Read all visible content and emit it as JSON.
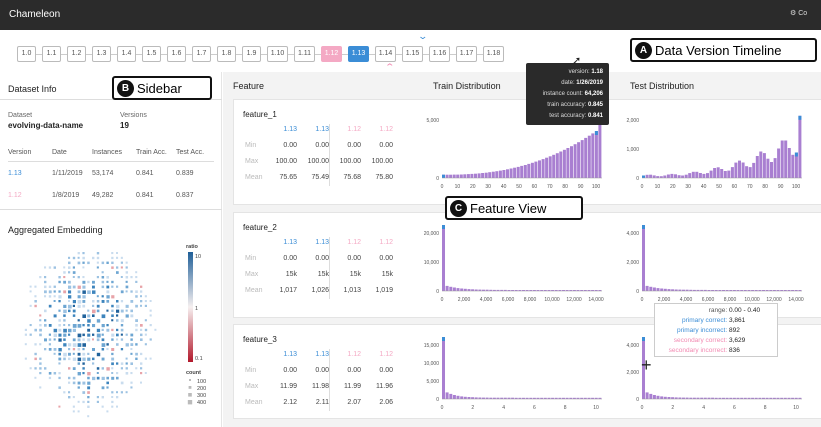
{
  "app": {
    "title": "Chameleon",
    "right_label": "Co"
  },
  "versions": [
    "1.0",
    "1.1",
    "1.2",
    "1.3",
    "1.4",
    "1.5",
    "1.6",
    "1.7",
    "1.8",
    "1.9",
    "1.10",
    "1.11",
    "1.12",
    "1.13",
    "1.14",
    "1.15",
    "1.16",
    "1.17",
    "1.18"
  ],
  "selected": {
    "primary": "1.13",
    "secondary": "1.12"
  },
  "annotations": {
    "a": {
      "letter": "A",
      "label": "Data Version Timeline"
    },
    "b": {
      "letter": "B",
      "label": "Sidebar"
    },
    "c": {
      "letter": "C",
      "label": "Feature View"
    }
  },
  "hover_tooltip": {
    "rows": [
      {
        "k": "version:",
        "v": "1.18"
      },
      {
        "k": "date:",
        "v": "1/26/2019"
      },
      {
        "k": "instance count:",
        "v": "64,206"
      },
      {
        "k": "train accuracy:",
        "v": "0.845"
      },
      {
        "k": "test accuracy:",
        "v": "0.841"
      }
    ]
  },
  "sidebar": {
    "dataset_info_title": "Dataset Info",
    "dataset_label": "Dataset",
    "dataset_name": "evolving-data-name",
    "versions_label": "Versions",
    "versions_count": "19",
    "columns": [
      "Version",
      "Date",
      "Instances",
      "Train Acc.",
      "Test Acc."
    ],
    "rows": [
      {
        "version": "1.13",
        "date": "1/11/2019",
        "instances": "53,174",
        "train": "0.841",
        "test": "0.839",
        "color": "#3b8dd6"
      },
      {
        "version": "1.12",
        "date": "1/8/2019",
        "instances": "49,282",
        "train": "0.841",
        "test": "0.837",
        "color": "#f4a9c4"
      }
    ],
    "embedding_title": "Aggregated Embedding",
    "legend": {
      "ratio_label": "ratio",
      "ratio_top": "10",
      "ratio_mid": "1",
      "ratio_bottom": "0.1",
      "count_label": "count",
      "counts": [
        "100",
        "200",
        "300",
        "400"
      ]
    }
  },
  "headers": {
    "feature": "Feature",
    "train": "Train Distribution",
    "test": "Test Distribution"
  },
  "colors": {
    "primary": "#3b8dd6",
    "secondary": "#f4a9c4",
    "bar": "#a97fd1",
    "bar_highlight": "#3b8dd6"
  },
  "features": [
    {
      "name": "feature_1",
      "cols": [
        "1.13",
        "1.13",
        "1.12",
        "1.12"
      ],
      "stats": [
        {
          "label": "Min",
          "values": [
            "0.00",
            "0.00",
            "0.00",
            "0.00"
          ]
        },
        {
          "label": "Max",
          "values": [
            "100.00",
            "100.00",
            "100.00",
            "100.00"
          ]
        },
        {
          "label": "Mean",
          "values": [
            "75.65",
            "75.49",
            "75.68",
            "75.80"
          ]
        }
      ],
      "train_axis": {
        "y": [
          "5,000",
          "0"
        ],
        "x": [
          "0",
          "10",
          "20",
          "30",
          "40",
          "50",
          "60",
          "70",
          "80",
          "90",
          "100"
        ]
      },
      "test_axis": {
        "y": [
          "2,000",
          "1,000",
          "0"
        ],
        "x": [
          "0",
          "10",
          "20",
          "30",
          "40",
          "50",
          "60",
          "70",
          "80",
          "90",
          "100"
        ]
      }
    },
    {
      "name": "feature_2",
      "cols": [
        "1.13",
        "1.13",
        "1.12",
        "1.12"
      ],
      "stats": [
        {
          "label": "Min",
          "values": [
            "0.00",
            "0.00",
            "0.00",
            "0.00"
          ]
        },
        {
          "label": "Max",
          "values": [
            "15k",
            "15k",
            "15k",
            "15k"
          ]
        },
        {
          "label": "Mean",
          "values": [
            "1,017",
            "1,026",
            "1,013",
            "1,019"
          ]
        }
      ],
      "train_axis": {
        "y": [
          "20,000",
          "10,000",
          "0"
        ],
        "x": [
          "0",
          "2,000",
          "4,000",
          "6,000",
          "8,000",
          "10,000",
          "12,000",
          "14,000"
        ]
      },
      "test_axis": {
        "y": [
          "4,000",
          "2,000",
          "0"
        ],
        "x": [
          "0",
          "2,000",
          "4,000",
          "6,000",
          "8,000",
          "10,000",
          "12,000",
          "14,000"
        ]
      }
    },
    {
      "name": "feature_3",
      "cols": [
        "1.13",
        "1.13",
        "1.12",
        "1.12"
      ],
      "stats": [
        {
          "label": "Min",
          "values": [
            "0.00",
            "0.00",
            "0.00",
            "0.00"
          ]
        },
        {
          "label": "Max",
          "values": [
            "11.99",
            "11.98",
            "11.99",
            "11.96"
          ]
        },
        {
          "label": "Mean",
          "values": [
            "2.12",
            "2.11",
            "2.07",
            "2.06"
          ]
        }
      ],
      "train_axis": {
        "y": [
          "15,000",
          "10,000",
          "5,000",
          "0"
        ],
        "x": [
          "0",
          "2",
          "4",
          "6",
          "8",
          "10"
        ]
      },
      "test_axis": {
        "y": [
          "4,000",
          "2,000",
          "0"
        ],
        "x": [
          "0",
          "2",
          "4",
          "6",
          "8",
          "10"
        ]
      }
    }
  ],
  "range_tooltip": {
    "rows": [
      {
        "k": "range:",
        "v": "0.00 - 0.40",
        "kc": "#555"
      },
      {
        "k": "primary correct:",
        "v": "3,861",
        "kc": "#3b8dd6"
      },
      {
        "k": "primary incorrect:",
        "v": "892",
        "kc": "#3b8dd6"
      },
      {
        "k": "secondary correct:",
        "v": "3,629",
        "kc": "#f28ab2"
      },
      {
        "k": "secondary incorrect:",
        "v": "836",
        "kc": "#f28ab2"
      }
    ]
  }
}
